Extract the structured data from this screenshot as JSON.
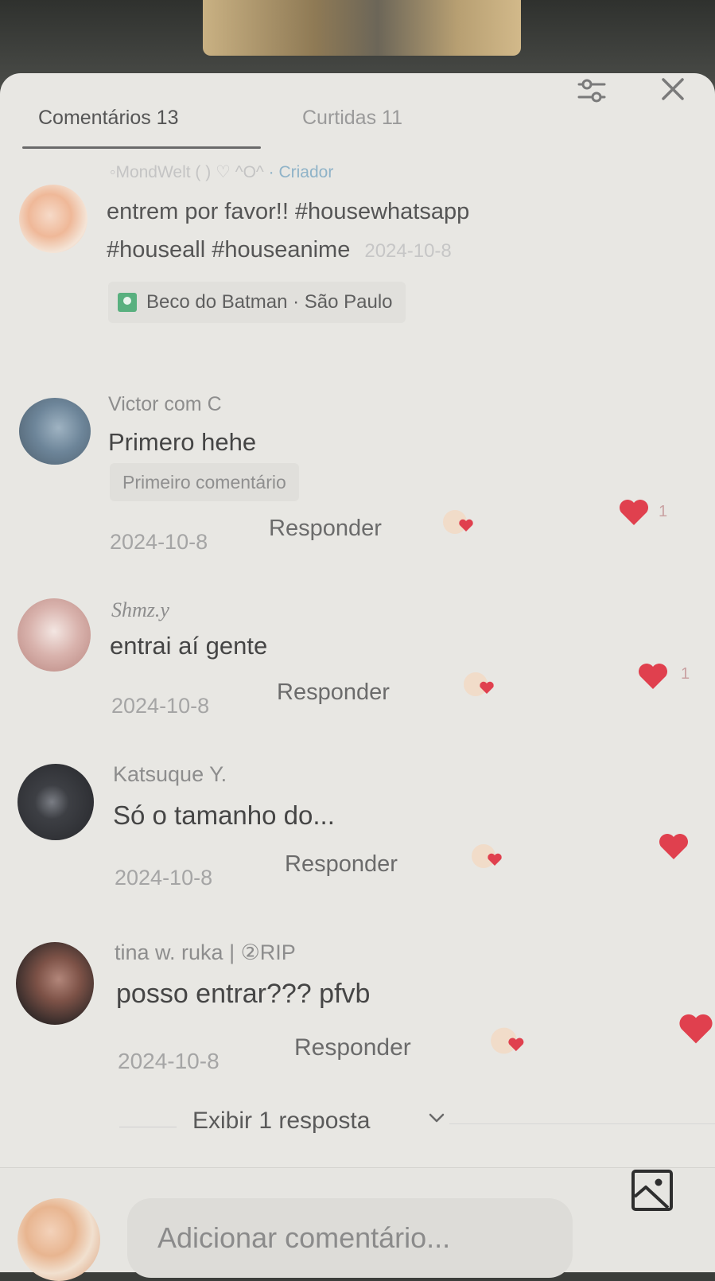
{
  "tabs": {
    "comments": "Comentários 13",
    "likes": "Curtidas 11"
  },
  "pinned": {
    "username_visible": "◦MondWelt ( ) ♡ ^O^",
    "creator_label": "· Criador",
    "text_line1": "entrem por favor!! #housewhatsapp",
    "text_line2": "#houseall #houseanime",
    "date": "2024-10-8",
    "location": "Beco do Batman · São Paulo"
  },
  "comments": [
    {
      "username": "Victor com C",
      "text": "Primero hehe",
      "badge": "Primeiro comentário",
      "date": "2024-10-8",
      "reply": "Responder",
      "likes": "1"
    },
    {
      "username": "Shmz.y",
      "text": "entrai aí gente",
      "date": "2024-10-8",
      "reply": "Responder",
      "likes": "1"
    },
    {
      "username": "Katsuque Y.",
      "text": "Só o tamanho do...",
      "date": "2024-10-8",
      "reply": "Responder",
      "likes": ""
    },
    {
      "username": "tina w. ruka | ②RIP",
      "text": "posso entrar??? pfvb",
      "date": "2024-10-8",
      "reply": "Responder",
      "likes": ""
    }
  ],
  "show_replies": "Exibir 1 resposta",
  "input": {
    "placeholder": "Adicionar comentário..."
  },
  "colors": {
    "heart": "#e0404e",
    "sheet_bg": "#e8e7e3",
    "creator": "#8fb3c8"
  },
  "icons": [
    "filter-icon",
    "close-icon",
    "heart-icon",
    "chevron-down-icon",
    "image-icon",
    "location-pin-icon"
  ]
}
